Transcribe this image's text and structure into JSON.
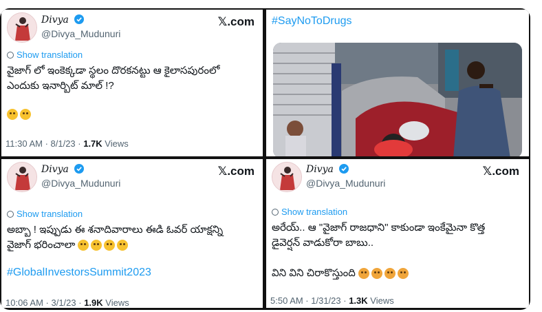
{
  "cards": [
    {
      "author": "Divya",
      "handle": "@Divya_Mudunuri",
      "brand": "𝕏.com",
      "translate_label": "Show translation",
      "text_lines": [
        "వైజాగ్ లో ఇంకెక్కడా స్థలం దొరకనట్టు ఆ కైలాసపురంలో",
        "ఎందుకు ఇనార్బిట్ మాల్ !?"
      ],
      "meta_time": "11:30 AM · 8/1/23 · ",
      "views_count": "1.7K",
      "views_label": " Views"
    },
    {
      "hashtag": "#SayNoToDrugs"
    },
    {
      "author": "Divya",
      "handle": "@Divya_Mudunuri",
      "brand": "𝕏.com",
      "translate_label": "Show translation",
      "text_lines": [
        "అబ్బా ! ఇప్పుడు ఈ శనాదివారాలు ఈడి ఓవర్ యాక్షన్ని",
        "వైజాగ్ భరించాలా"
      ],
      "hashtag": "#GlobalInvestorsSummit2023",
      "meta_time": "10:06 AM · 3/1/23 · ",
      "views_count": "1.9K",
      "views_label": " Views"
    },
    {
      "author": "Divya",
      "handle": "@Divya_Mudunuri",
      "brand": "𝕏.com",
      "translate_label": "Show translation",
      "text_lines": [
        "అరేయ్.. ఆ \"వైజాగ్ రాజధాని\" కాకుండా ఇంకేమైనా కొత్త",
        "డైవెర్షన్ వాడుకోరా బాబు..",
        "",
        "విని విని చిరాకొస్తుంది"
      ],
      "meta_time": "5:50 AM · 1/31/23 · ",
      "views_count": "1.3K",
      "views_label": " Views"
    }
  ],
  "colors": {
    "link": "#1d9bf0",
    "text": "#0f1419",
    "muted": "#536471",
    "divider": "#111111"
  }
}
